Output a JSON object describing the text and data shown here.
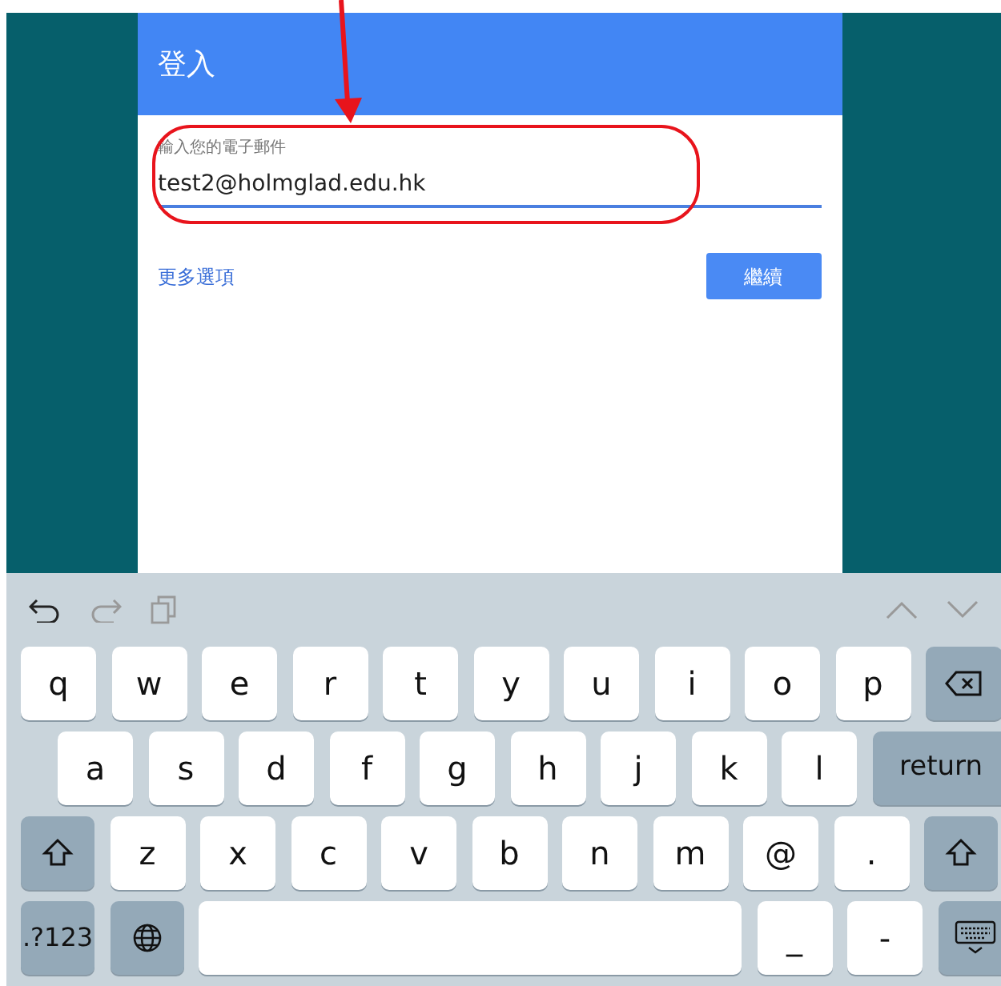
{
  "dialog": {
    "title": "登入",
    "field": {
      "label": "輸入您的電子郵件",
      "value": "test2@holmglad.edu.hk"
    },
    "link": "更多選項",
    "button": "繼續"
  },
  "keyboard": {
    "rows": [
      [
        {
          "kind": "char",
          "label": "q"
        },
        {
          "kind": "char",
          "label": "w"
        },
        {
          "kind": "char",
          "label": "e"
        },
        {
          "kind": "char",
          "label": "r"
        },
        {
          "kind": "char",
          "label": "t"
        },
        {
          "kind": "char",
          "label": "y"
        },
        {
          "kind": "char",
          "label": "u"
        },
        {
          "kind": "char",
          "label": "i"
        },
        {
          "kind": "char",
          "label": "o"
        },
        {
          "kind": "char",
          "label": "p"
        },
        {
          "kind": "backspace"
        }
      ],
      [
        {
          "kind": "char",
          "label": "a"
        },
        {
          "kind": "char",
          "label": "s"
        },
        {
          "kind": "char",
          "label": "d"
        },
        {
          "kind": "char",
          "label": "f"
        },
        {
          "kind": "char",
          "label": "g"
        },
        {
          "kind": "char",
          "label": "h"
        },
        {
          "kind": "char",
          "label": "j"
        },
        {
          "kind": "char",
          "label": "k"
        },
        {
          "kind": "char",
          "label": "l"
        },
        {
          "kind": "return",
          "label": "return"
        }
      ],
      [
        {
          "kind": "shift"
        },
        {
          "kind": "char",
          "label": "z"
        },
        {
          "kind": "char",
          "label": "x"
        },
        {
          "kind": "char",
          "label": "c"
        },
        {
          "kind": "char",
          "label": "v"
        },
        {
          "kind": "char",
          "label": "b"
        },
        {
          "kind": "char",
          "label": "n"
        },
        {
          "kind": "char",
          "label": "m"
        },
        {
          "kind": "char",
          "label": "@"
        },
        {
          "kind": "char",
          "label": "."
        },
        {
          "kind": "shift"
        }
      ],
      [
        {
          "kind": "function",
          "label": ".?123"
        },
        {
          "kind": "globe"
        },
        {
          "kind": "space"
        },
        {
          "kind": "char",
          "label": "_"
        },
        {
          "kind": "char",
          "label": "-"
        },
        {
          "kind": "hide"
        }
      ]
    ]
  }
}
